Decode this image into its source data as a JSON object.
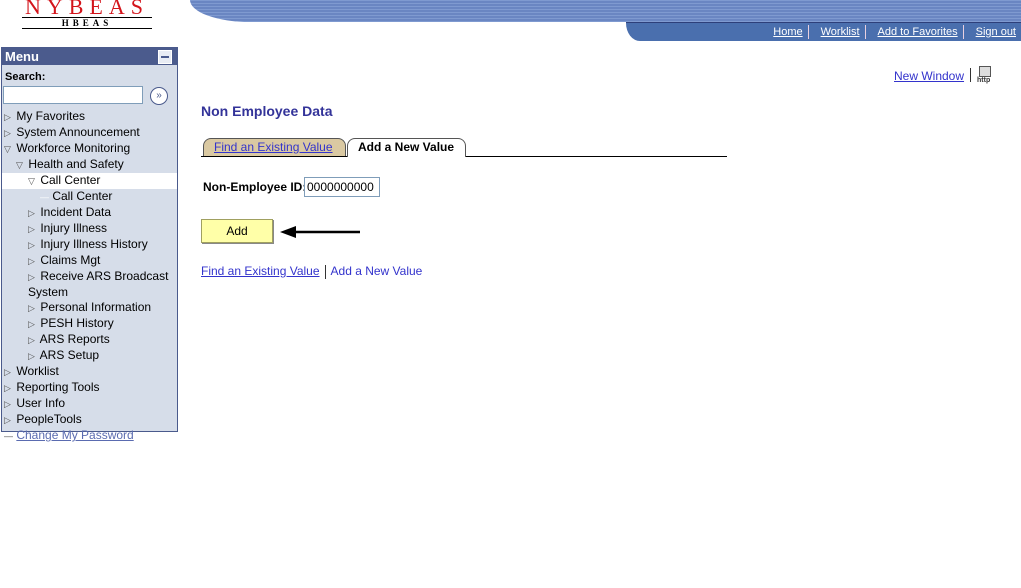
{
  "logo": {
    "main": "NYBEAS",
    "sub": "HBEAS"
  },
  "topnav": [
    "Home",
    "Worklist",
    "Add to Favorites",
    "Sign out"
  ],
  "menu": {
    "title": "Menu",
    "search_label": "Search:",
    "search_value": "",
    "items": [
      {
        "label": "My Favorites",
        "level": 0,
        "icon": "triangle-right"
      },
      {
        "label": "System Announcement",
        "level": 0,
        "icon": "triangle-right"
      },
      {
        "label": "Workforce Monitoring",
        "level": 0,
        "icon": "triangle-down"
      },
      {
        "label": "Health and Safety",
        "level": 1,
        "icon": "triangle-down"
      },
      {
        "label": "Call Center",
        "level": 2,
        "icon": "triangle-down",
        "state": "open"
      },
      {
        "label": "Call Center",
        "level": 3,
        "icon": "dash",
        "state": "selected"
      },
      {
        "label": "Incident Data",
        "level": 2,
        "icon": "triangle-right"
      },
      {
        "label": "Injury Illness",
        "level": 2,
        "icon": "triangle-right"
      },
      {
        "label": "Injury Illness History",
        "level": 2,
        "icon": "triangle-right"
      },
      {
        "label": "Claims Mgt",
        "level": 2,
        "icon": "triangle-right"
      },
      {
        "label": "Receive ARS Broadcast System",
        "level": 2,
        "icon": "triangle-right"
      },
      {
        "label": "Personal Information",
        "level": 2,
        "icon": "triangle-right"
      },
      {
        "label": "PESH History",
        "level": 2,
        "icon": "triangle-right"
      },
      {
        "label": "ARS Reports",
        "level": 2,
        "icon": "triangle-right"
      },
      {
        "label": "ARS Setup",
        "level": 2,
        "icon": "triangle-right"
      },
      {
        "label": "Worklist",
        "level": 0,
        "icon": "triangle-right"
      },
      {
        "label": "Reporting Tools",
        "level": 0,
        "icon": "triangle-right"
      },
      {
        "label": "User Info",
        "level": 0,
        "icon": "triangle-right"
      },
      {
        "label": "PeopleTools",
        "level": 0,
        "icon": "triangle-right"
      },
      {
        "label": "Change My Password",
        "level": 0,
        "icon": "dash",
        "state": "link"
      }
    ]
  },
  "header": {
    "new_window": "New Window",
    "http_icon_text": "http"
  },
  "page": {
    "title": "Non Employee Data",
    "tabs": [
      {
        "label": "Find an Existing Value",
        "active": false
      },
      {
        "label": "Add a New Value",
        "active": true
      }
    ],
    "field_label": "Non-Employee ID:",
    "field_value": "0000000000",
    "add_button": "Add",
    "bottom_links": [
      "Find an Existing Value",
      "Add a New Value"
    ]
  }
}
